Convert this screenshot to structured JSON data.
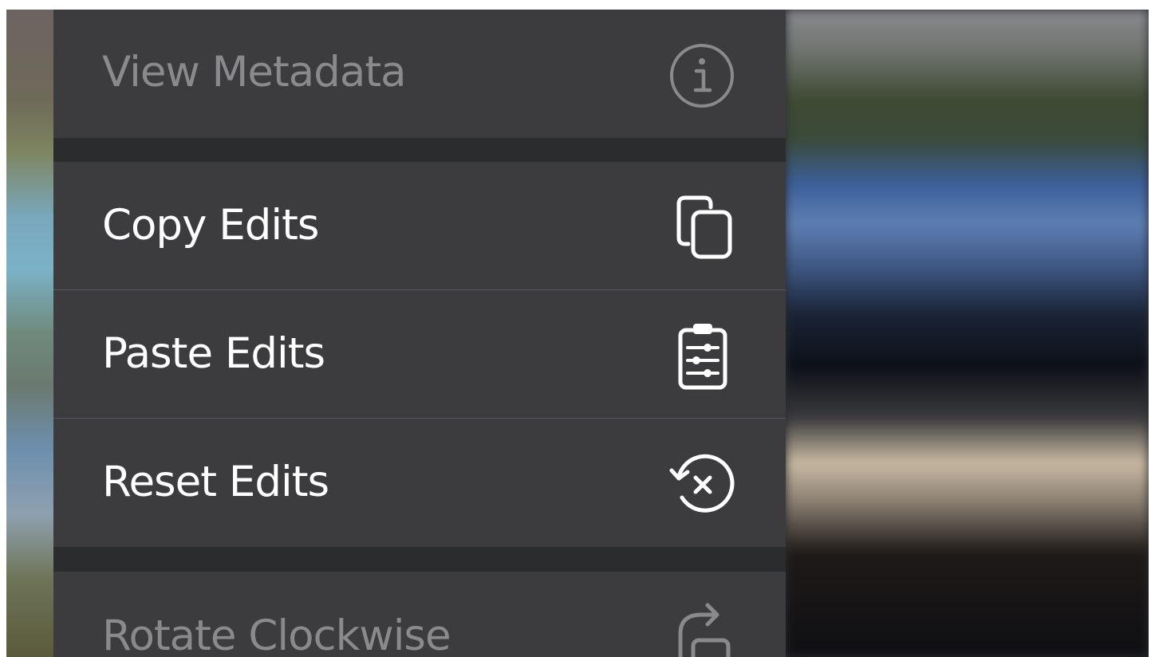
{
  "context_menu": {
    "items": [
      {
        "label": "View Metadata",
        "icon": "info-circle-icon",
        "enabled": false
      },
      {
        "label": "Copy Edits",
        "icon": "copy-icon",
        "enabled": true
      },
      {
        "label": "Paste Edits",
        "icon": "clipboard-adjustments-icon",
        "enabled": true
      },
      {
        "label": "Reset Edits",
        "icon": "revert-x-circle-icon",
        "enabled": true
      },
      {
        "label": "Rotate Clockwise",
        "icon": "rotate-clockwise-icon",
        "enabled": false
      }
    ]
  },
  "colors": {
    "menu_background": "#3c3c3e",
    "group_gap": "#2b2c2e",
    "enabled_text": "#ffffff",
    "disabled_text": "#8a8a8d"
  }
}
